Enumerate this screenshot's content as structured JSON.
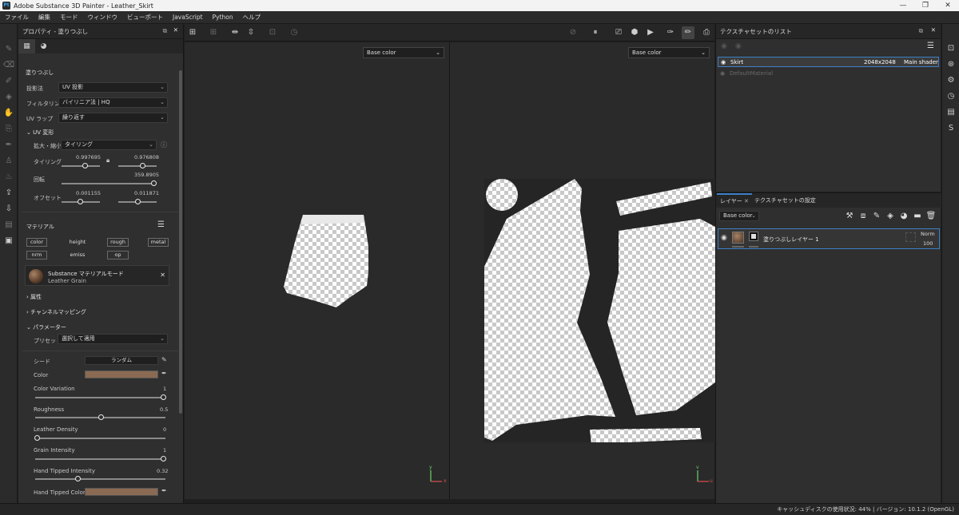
{
  "window": {
    "title": "Adobe Substance 3D Painter - Leather_Skirt",
    "app_icon": "Pt",
    "minimize": "—",
    "maximize": "❐",
    "close": "✕"
  },
  "menu": [
    "ファイル",
    "編集",
    "モード",
    "ウィンドウ",
    "ビューポート",
    "JavaScript",
    "Python",
    "ヘルプ"
  ],
  "properties": {
    "title": "プロパティ - 塗りつぶし",
    "section_fill": "塗りつぶし",
    "projection_label": "投影法",
    "projection_value": "UV 投影",
    "filtering_label": "フィルタリング",
    "filtering_value": "バイリニア法 | HQ",
    "uvwrap_label": "UV ラップ",
    "uvwrap_value": "繰り返す",
    "uv_transform": "UV 変形",
    "scale_label": "拡大・縮小",
    "scale_value": "タイリング",
    "tiling_label": "タイリング",
    "tiling_u": "0.997695",
    "tiling_v": "0.976808",
    "rotation_label": "回転",
    "rotation_value": "359.8905",
    "offset_label": "オフセット",
    "offset_u": "0.001155",
    "offset_v": "0.011871",
    "material_label": "マテリアル",
    "channels": [
      "color",
      "height",
      "rough",
      "metal",
      "nrm",
      "emiss",
      "op"
    ],
    "material_name": "Substance マテリアルモード",
    "material_sub": "Leather Grain",
    "attributes": "属性",
    "channel_mapping": "チャンネルマッピング",
    "parameters": "パラメーター",
    "preset_label": "プリセット",
    "preset_value": "選択して適用",
    "seed_label": "シード",
    "seed_value": "ランダム",
    "color_label": "Color",
    "color_swatch": "#8a6a52",
    "color_variation_label": "Color Variation",
    "color_variation_value": "1",
    "roughness_label": "Roughness",
    "roughness_value": "0.5",
    "leather_density_label": "Leather Density",
    "leather_density_value": "0",
    "grain_intensity_label": "Grain Intensity",
    "grain_intensity_value": "1",
    "hand_tipped_intensity_label": "Hand Tipped Intensity",
    "hand_tipped_intensity_value": "0.32",
    "hand_tipped_color_label": "Hand Tipped Color",
    "hand_tipped_color_swatch": "#8a6a52"
  },
  "viewport": {
    "left_channel": "Base color",
    "right_channel": "Base color",
    "axis_3d": [
      "y",
      "x"
    ],
    "axis_2d": [
      "v",
      "u"
    ]
  },
  "texture_sets": {
    "title": "テクスチャセットのリスト",
    "rows": [
      {
        "name": "Skirt",
        "size": "2048x2048",
        "shader": "Main shader"
      },
      {
        "name": "DefaultMaterial",
        "size": "",
        "shader": ""
      }
    ]
  },
  "layers": {
    "tab_layers": "レイヤー",
    "tab_settings": "テクスチャセットの設定",
    "channel": "Base color",
    "layer_name": "塗りつぶしレイヤー 1",
    "blend": "Norm",
    "opacity": "100"
  },
  "status": {
    "text": "キャッシュディスクの使用状況:   44%  |  バージョン: 10.1.2 (OpenGL)"
  },
  "colors": {
    "accent": "#3d7fc7",
    "panel": "#2f2f2f",
    "viewport": "#2a2a2a"
  }
}
